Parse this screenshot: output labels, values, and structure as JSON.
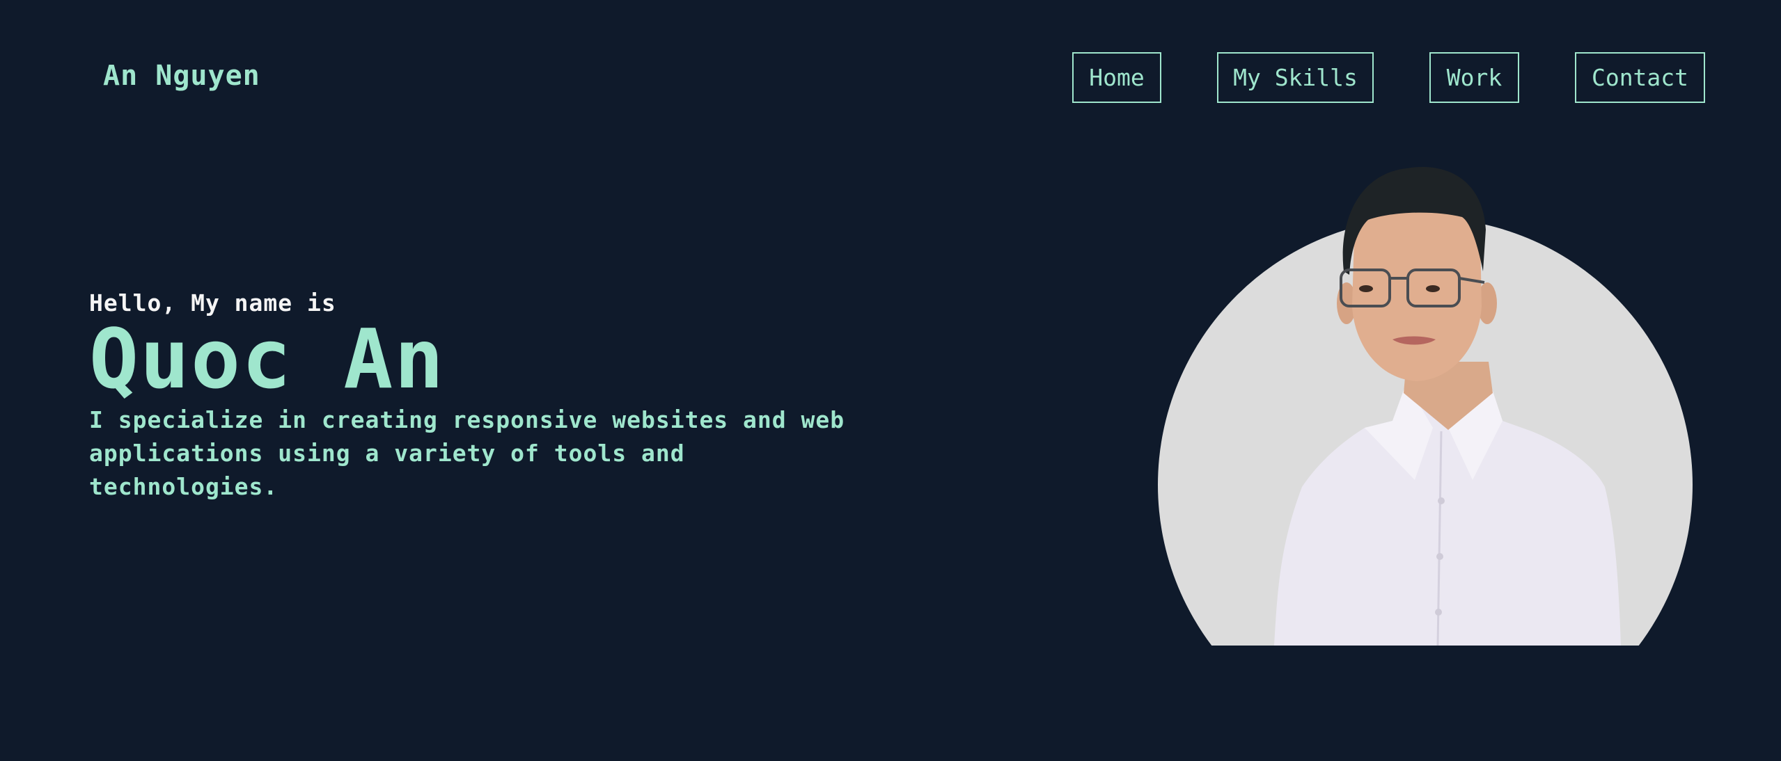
{
  "header": {
    "logo": "An Nguyen",
    "nav": [
      "Home",
      "My Skills",
      "Work",
      "Contact"
    ]
  },
  "hero": {
    "greeting": "Hello, My name is",
    "name": "Quoc An",
    "description": "I specialize in creating responsive websites and web applications using a variety of tools and technologies."
  },
  "colors": {
    "background": "#0f1a2b",
    "accent": "#9fe6cd",
    "text": "#f5f5f5",
    "photo_backdrop": "#dcdcdc"
  }
}
